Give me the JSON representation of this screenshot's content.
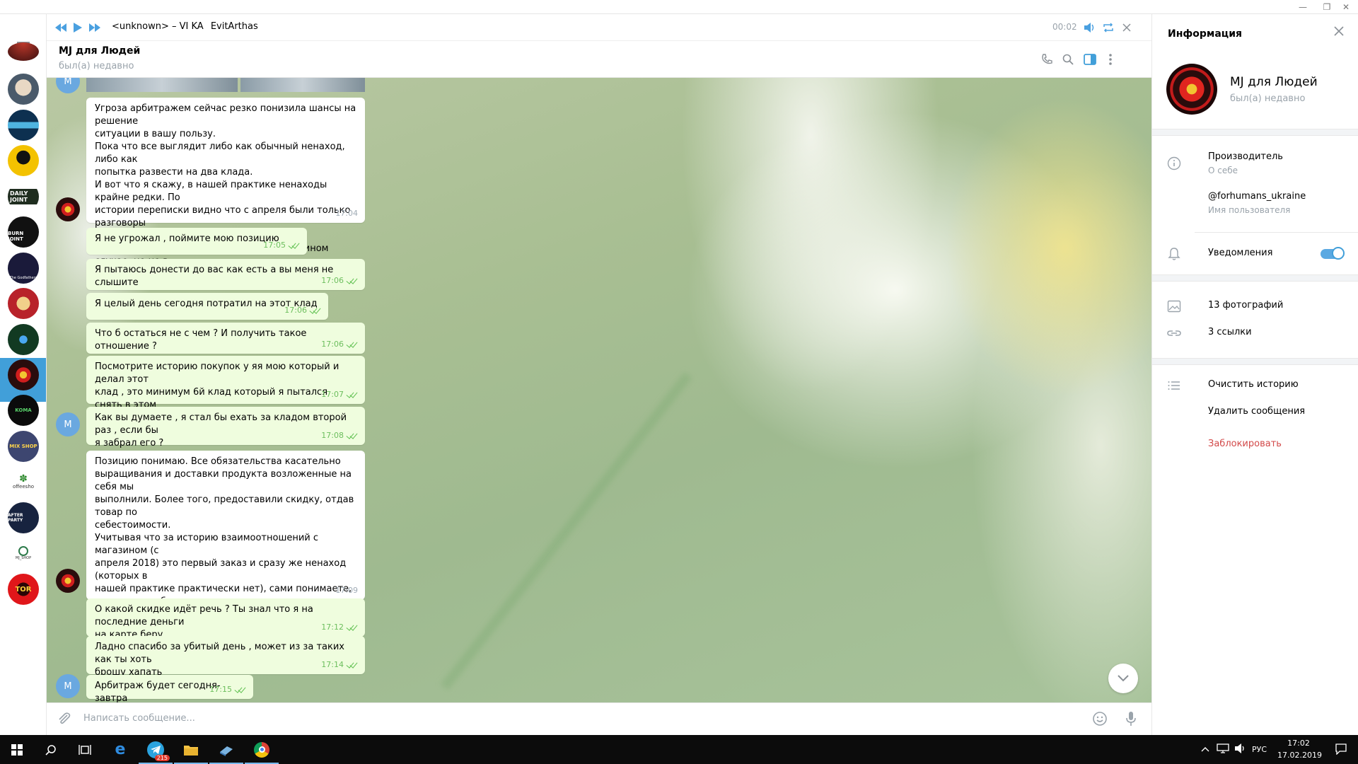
{
  "window": {
    "minimize": "—",
    "restore": "❐",
    "close": "✕"
  },
  "player": {
    "track_title": "<unknown> – VI KA",
    "track_artist": "EvitArthas",
    "time": "00:02"
  },
  "header": {
    "peer_name": "MJ для Людей",
    "peer_status": "был(а) недавно"
  },
  "messages": [
    {
      "dir": "in",
      "text": "Угроза арбитражем сейчас резко понизила шансы на решение\nситуации в вашу пользу.\nПока что все выглядит либо как обычный ненаход, либо как\nпопытка развести на два клада.\nИ вот что я скажу, в нашей практике ненаходы крайне редки. По\nистории переписки видно что с апреля были только разговоры\nи ни одного другого заказа.\nМожно было бы говорить о перезакладе в ином случае, но не в\nэтом.",
      "time": "17:04"
    },
    {
      "dir": "out",
      "text": "Я не угрожал , поймите мою позицию",
      "time": "17:05"
    },
    {
      "dir": "out",
      "text": "Я пытаюсь донести до вас как есть а вы меня не слышите",
      "time": "17:06"
    },
    {
      "dir": "out",
      "text": "Я целый день сегодня потратил на этот клад",
      "time": "17:06"
    },
    {
      "dir": "out",
      "text": "Что б остаться не с чем ? И получить такое отношение ?",
      "time": "17:06"
    },
    {
      "dir": "out",
      "text": "Посмотрите историю покупок у яя мою который и делал этот\nклад , это минимум 6й клад который я пытался снять в этом\nпарке на нивках и раньше все ровно было",
      "time": "17:07"
    },
    {
      "dir": "out",
      "text": "Как вы думаете , я стал бы ехать за кладом второй раз , если бы\nя забрал его ?",
      "time": "17:08"
    },
    {
      "dir": "in",
      "text": "Позицию понимаю. Все обязательства касательно\nвыращивания и доставки продукта возложенные на себя мы\nвыполнили. Более того, предоставили скидку, отдав товар по\nсебестоимости.\nУчитывая что за историю взаимоотношений с магазином (с\nапреля 2018) это первый заказ и сразу же ненаход (которых в\nнашей практике практически нет), сами понимаете,\nперезаклада быть не может.\nМаксимум что могу предложить это скидку на следующий клад/\nотправку.\nСообщите, пожалуйста, о своем решении.",
      "time": "17:09"
    },
    {
      "dir": "out",
      "text": "О какой скидке идёт речь ? Ты знал что я на последние деньги\nна карте беру",
      "time": "17:12"
    },
    {
      "dir": "out",
      "text": "Ладно спасибо за убитый день , может из за таких как ты хоть\nброшу хапать",
      "time": "17:14"
    },
    {
      "dir": "out",
      "text": "Арбитраж будет сегодня-завтра",
      "time": "17:15"
    }
  ],
  "avatar_letter": "M",
  "compose": {
    "placeholder": "Написать сообщение..."
  },
  "info": {
    "title": "Информация",
    "name": "MJ для Людей",
    "status": "был(а) недавно",
    "about": "Производитель",
    "about_label": "О себе",
    "username": "@forhumans_ukraine",
    "username_label": "Имя пользователя",
    "notifications": "Уведомления",
    "notifications_on": true,
    "photos": "13 фотографий",
    "links": "3 ссылки",
    "clear_history": "Очистить историю",
    "delete_messages": "Удалить сообщения",
    "block": "Заблокировать"
  },
  "rail_labels": [
    "DAILY JOINT",
    "BURN JOINT",
    "The Godfathers",
    "KOMA",
    "MIX SHOP",
    "offeesho",
    "AFTER PARTY",
    "MJ_SHOP",
    "TOR"
  ],
  "taskbar": {
    "telegram_badge": "215",
    "lang": "РУС",
    "time": "17:02",
    "date": "17.02.2019"
  },
  "colors": {
    "accent": "#419fd9",
    "outgoing_bubble": "#effdde",
    "read_tick": "#5ec04f",
    "danger": "#d24949"
  }
}
